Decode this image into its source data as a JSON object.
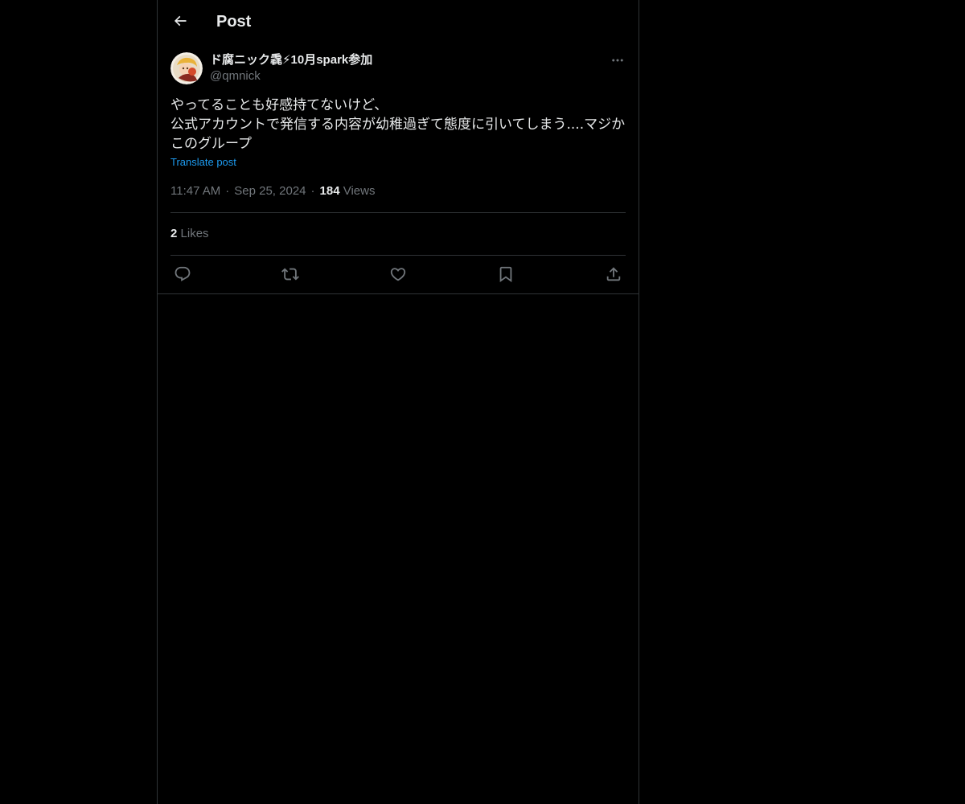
{
  "header": {
    "back_icon": "arrow-left-icon",
    "title": "Post"
  },
  "post": {
    "avatar_icon": "user-avatar",
    "display_name": "ド腐ニック毳⚡10月spark参加",
    "handle": "@qmnick",
    "more_icon": "more-horizontal-icon",
    "text_lines": [
      "やってることも好感持てないけど、",
      "公式アカウントで発信する内容が幼稚過ぎて態度に引いてしまう....マジか",
      "このグループ"
    ],
    "translate_label": "Translate post",
    "time": "11:47 AM",
    "date": "Sep 25, 2024",
    "separator": "·",
    "views_count": "184",
    "views_label": "Views",
    "likes_count": "2",
    "likes_label": "Likes"
  },
  "actions": [
    {
      "icon": "reply-icon"
    },
    {
      "icon": "repost-icon"
    },
    {
      "icon": "like-icon"
    },
    {
      "icon": "bookmark-icon"
    },
    {
      "icon": "share-icon"
    }
  ],
  "colors": {
    "background": "#000000",
    "text": "#e7e9ea",
    "secondary": "#71767b",
    "link": "#1d9bf0",
    "border": "#2f3336"
  }
}
